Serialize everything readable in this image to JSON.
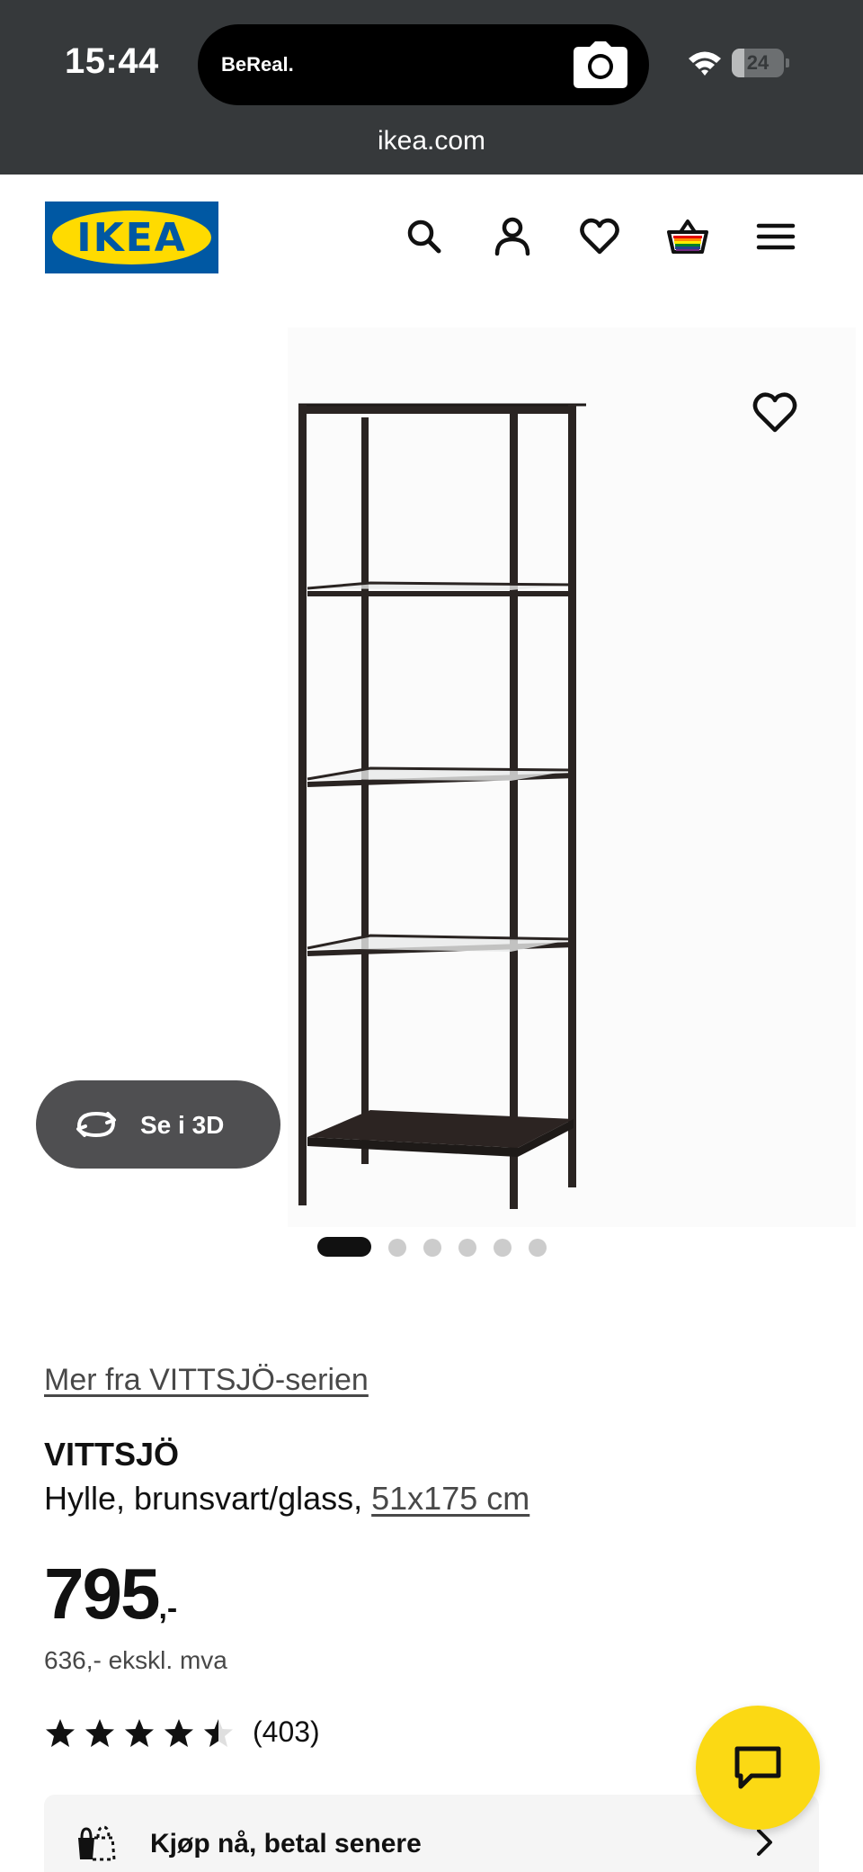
{
  "status_bar": {
    "time": "15:44",
    "island_app": "BeReal.",
    "battery": "24",
    "battery_level": 0.24,
    "url": "ikea.com"
  },
  "header": {
    "logo_text": "IKEA",
    "logo_reg": "®",
    "icons": [
      "search-icon",
      "account-icon",
      "heart-icon",
      "cart-icon",
      "menu-icon"
    ]
  },
  "gallery": {
    "btn_3d_label": "Se i 3D",
    "image_count": 6,
    "active_image": 1
  },
  "product": {
    "series_link": "Mer fra VITTSJÖ-serien",
    "name": "VITTSJÖ",
    "description": "Hylle, brunsvart/glass, ",
    "size": "51x175 cm",
    "price_int": "795",
    "price_dec": ",-",
    "price_ex_vat": "636,- ekskl. mva",
    "rating": 4.5,
    "rating_count": "(403)"
  },
  "bnpl": {
    "label": "Kjøp nå, betal senere"
  },
  "colors": {
    "status_bar": "#36393b",
    "ikea_blue": "#0058a3",
    "ikea_yellow": "#ffdb00",
    "chat_yellow": "#fbd914",
    "text": "#111111"
  }
}
